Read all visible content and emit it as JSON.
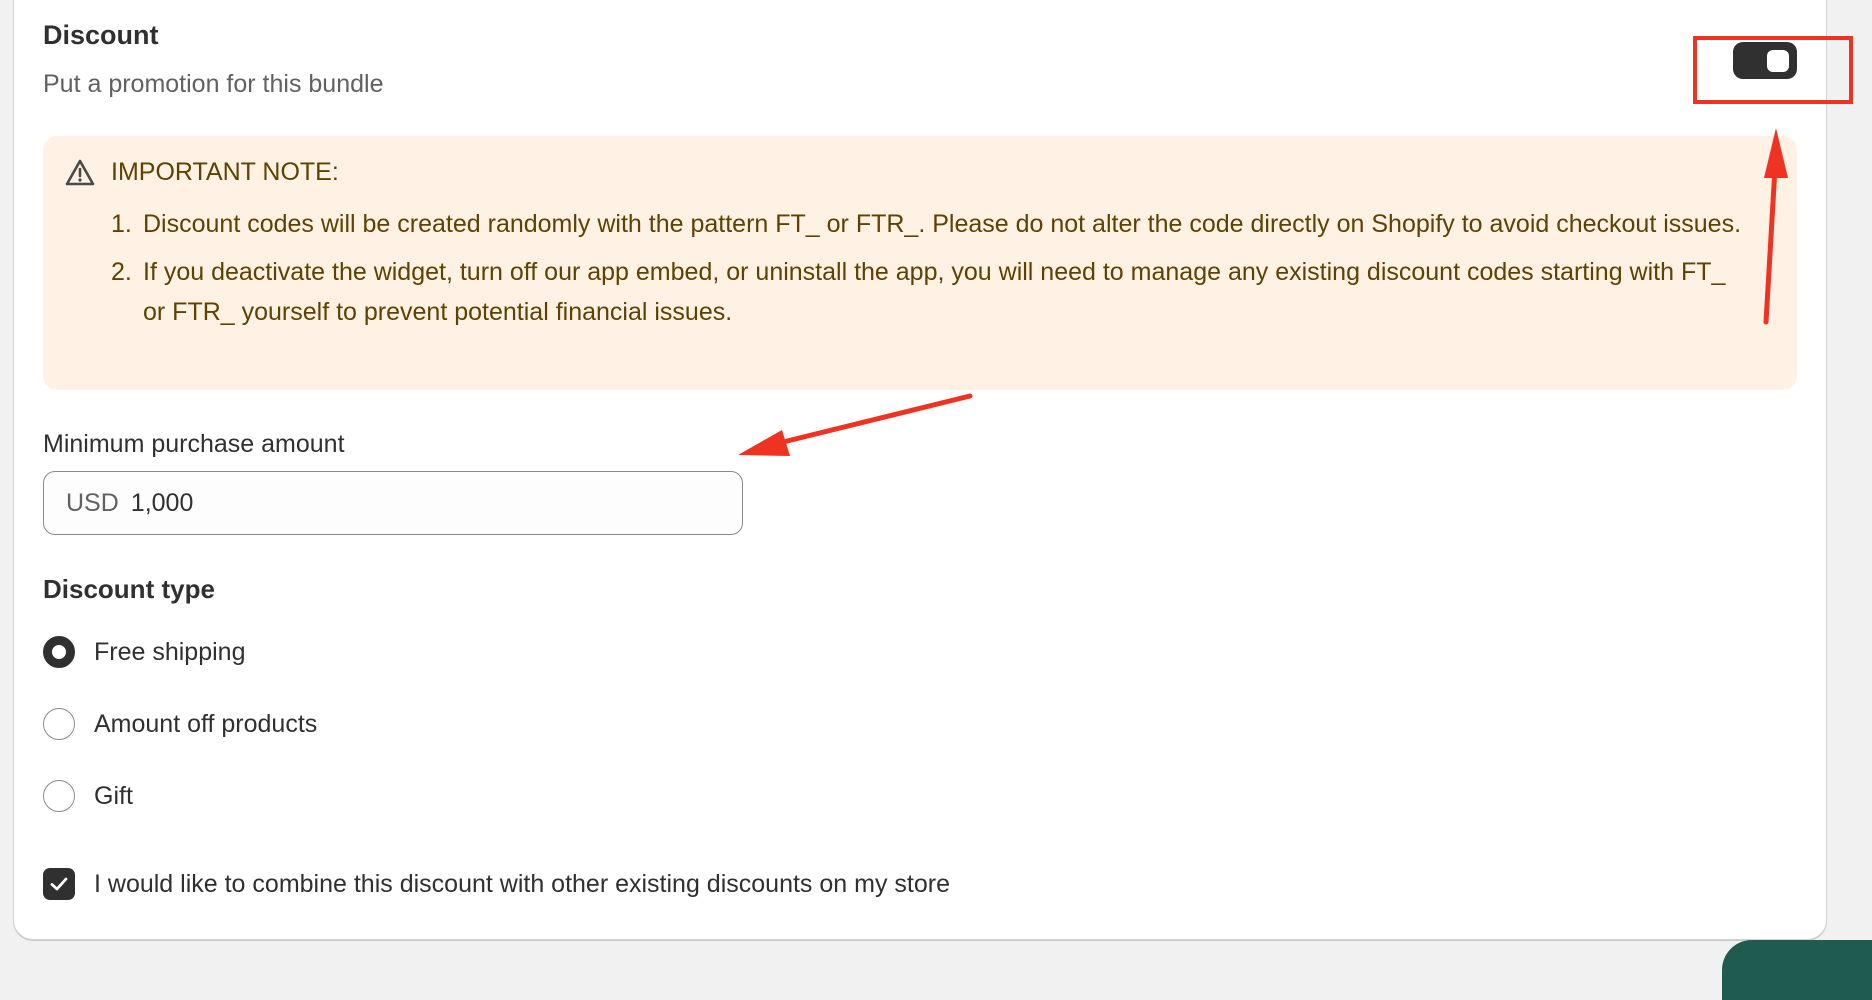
{
  "discount": {
    "title": "Discount",
    "subtitle": "Put a promotion for this bundle",
    "toggle_on": true
  },
  "notice": {
    "icon": "warning-triangle-icon",
    "heading": "IMPORTANT NOTE:",
    "items": [
      {
        "num": "1.",
        "text": "Discount codes will be created randomly with the pattern FT_ or FTR_. Please do not alter the code directly on Shopify to avoid checkout issues."
      },
      {
        "num": "2.",
        "text": "If you deactivate the widget, turn off our app embed, or uninstall the app, you will need to manage any existing discount codes starting with FT_ or FTR_ yourself to prevent potential financial issues."
      }
    ]
  },
  "min_purchase": {
    "label": "Minimum purchase amount",
    "prefix": "USD",
    "value": "1,000"
  },
  "discount_type": {
    "title": "Discount type",
    "options": [
      {
        "label": "Free shipping",
        "checked": true
      },
      {
        "label": "Amount off products",
        "checked": false
      },
      {
        "label": "Gift",
        "checked": false
      }
    ]
  },
  "combine": {
    "label": "I would like to combine this discount with other existing discounts on my store",
    "checked": true
  },
  "colors": {
    "annotation": "#ee3322",
    "notice_bg": "#fff1e3",
    "dark": "#303030"
  }
}
